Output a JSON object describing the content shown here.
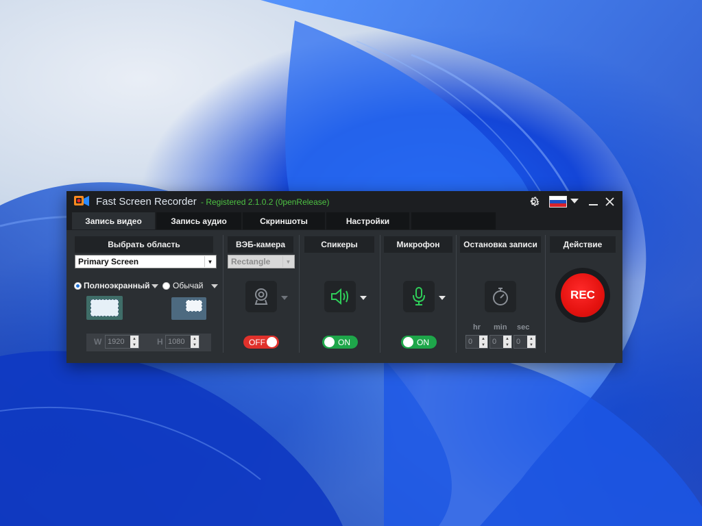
{
  "app": {
    "title": "Fast Screen Recorder",
    "registration": "- Registered 2.1.0.2 (0penRelease)"
  },
  "tabs": [
    {
      "label": "Запись видео",
      "active": true
    },
    {
      "label": "Запись аудио",
      "active": false
    },
    {
      "label": "Скриншоты",
      "active": false
    },
    {
      "label": "Настройки",
      "active": false
    },
    {
      "label": "",
      "active": false
    }
  ],
  "sections": {
    "area": "Выбрать область",
    "webcam": "ВЭБ-камера",
    "speakers": "Спикеры",
    "mic": "Микрофон",
    "stop": "Остановка записи",
    "action": "Действие"
  },
  "area": {
    "source_selected": "Primary Screen",
    "mode_fullscreen": "Полноэкранный",
    "mode_normal": "Обычай",
    "fullscreen_selected": true,
    "width_label": "W",
    "width_value": "1920",
    "height_label": "H",
    "height_value": "1080"
  },
  "webcam": {
    "shape_selected": "Rectangle",
    "state": "OFF",
    "icon": "webcam-icon"
  },
  "speakers": {
    "state": "ON",
    "icon": "speaker-icon"
  },
  "mic": {
    "state": "ON",
    "icon": "microphone-icon"
  },
  "stop": {
    "icon": "stopwatch-icon",
    "hr_label": "hr",
    "min_label": "min",
    "sec_label": "sec",
    "hr_value": "0",
    "min_value": "0",
    "sec_value": "0"
  },
  "action": {
    "rec_label": "REC"
  },
  "colors": {
    "accent_green": "#4ec243",
    "toggle_on": "#1ea64a",
    "toggle_off": "#e0312b",
    "rec_red": "#e4120f",
    "window_bg": "#2b2f33"
  },
  "titlebar_icons": [
    "gear-icon",
    "russia-flag-icon",
    "chevron-down-icon",
    "minimize-icon",
    "close-icon"
  ]
}
